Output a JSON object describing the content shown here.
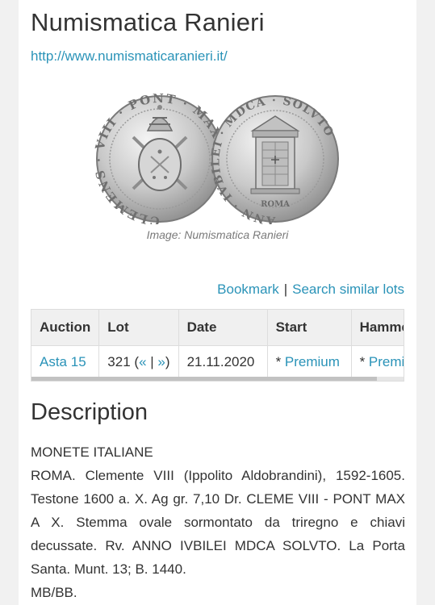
{
  "header": {
    "title": "Numismatica Ranieri",
    "url": "http://www.numismaticaranieri.it/"
  },
  "image": {
    "caption": "Image: Numismatica Ranieri",
    "obverse_legend": "CLEMENS · VIII · PONT · MAX",
    "reverse_legend": "ANN · IVBILEI · MDCA · SOLVTO",
    "reverse_mark": "ROMA"
  },
  "actions": {
    "bookmark": "Bookmark",
    "separator": "|",
    "search_similar": "Search similar lots"
  },
  "table": {
    "headers": [
      "Auction",
      "Lot",
      "Date",
      "Start",
      "Hammer"
    ],
    "row": {
      "auction": "Asta 15",
      "lot_number": "321",
      "lot_prefix": "(",
      "lot_prev": "«",
      "lot_sep": "|",
      "lot_next": "»",
      "lot_suffix": ")",
      "date": "21.11.2020",
      "start_star": "* ",
      "start_link": "Premium",
      "hammer_star": "* ",
      "hammer_link": "Premium"
    }
  },
  "description": {
    "heading": "Description",
    "line1": "MONETE ITALIANE",
    "body": "ROMA. Clemente VIII (Ippolito Aldobrandini), 1592-1605. Testone 1600 a. X. Ag gr. 7,10 Dr. CLEME VIII - PONT MAX A X. Stemma ovale sormontato da triregno e chiavi decussate. Rv. ANNO IVBILEI MDCA SOLVTO. La Porta Santa. Munt. 13; B. 1440.",
    "grade": "MB/BB."
  },
  "colors": {
    "link": "#2a93b8",
    "text": "#333333",
    "header_bg": "#f0f0f0"
  }
}
